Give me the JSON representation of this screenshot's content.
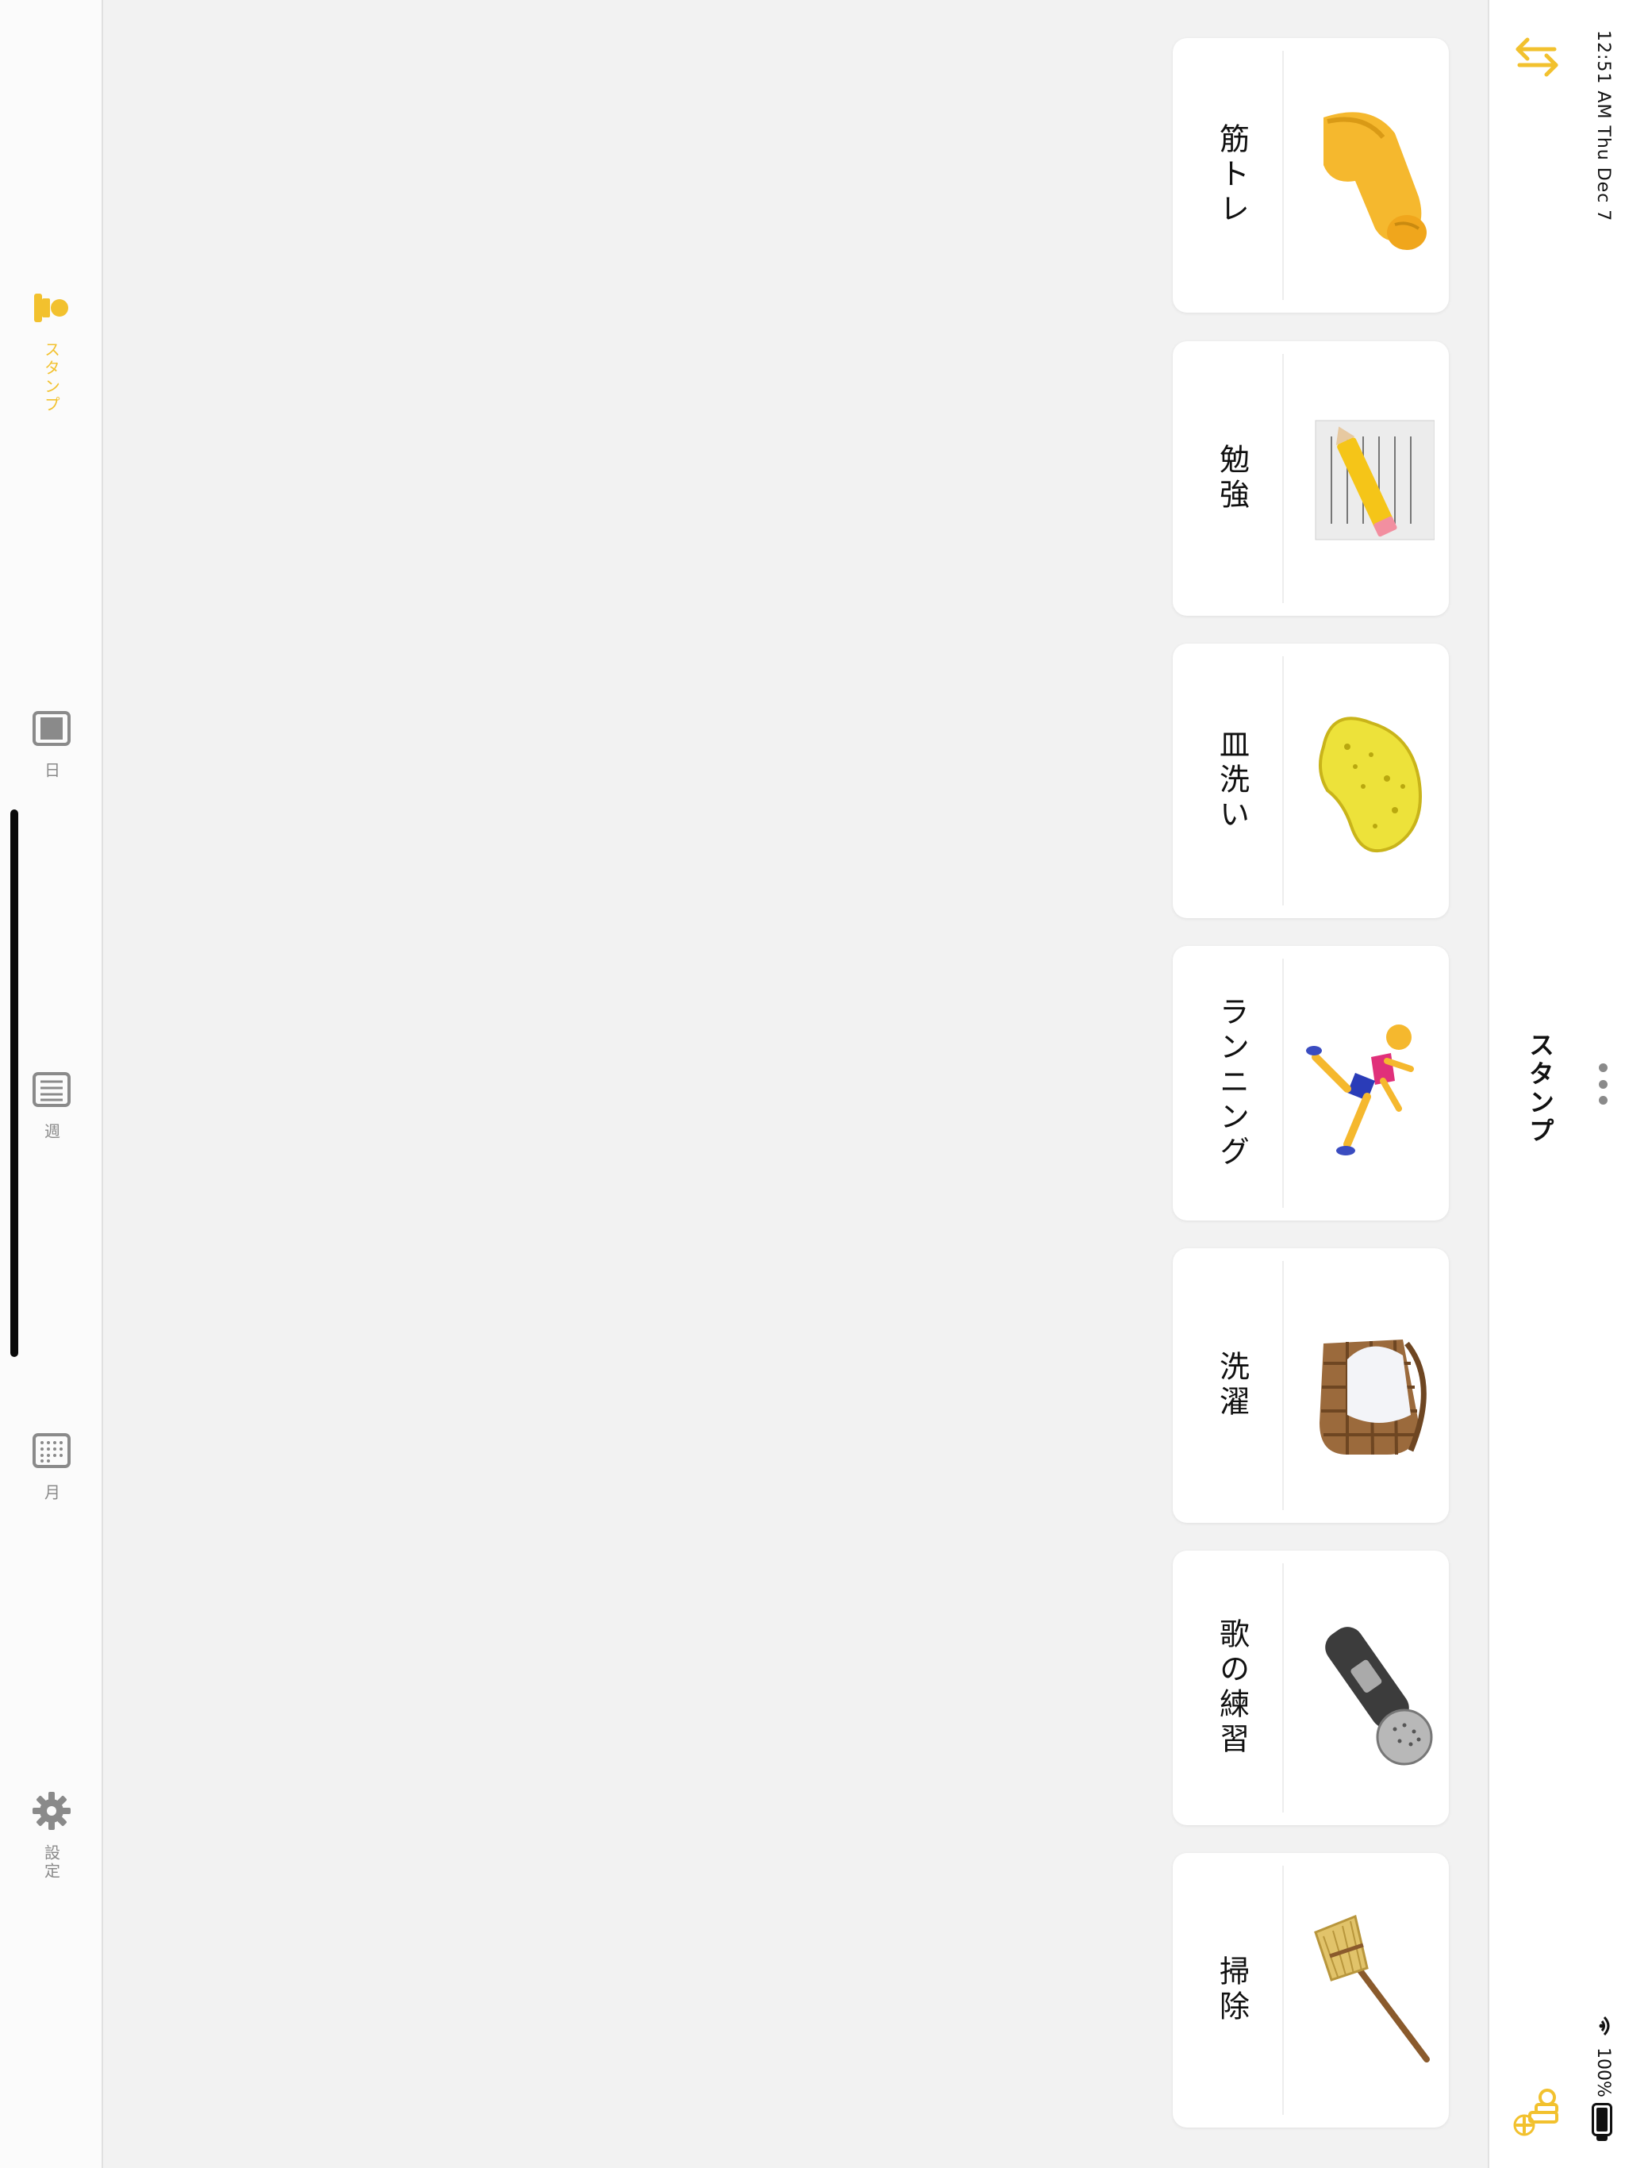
{
  "status_bar": {
    "time_date": "12:51 AM   Thu Dec 7",
    "battery": "100%"
  },
  "header": {
    "title": "スタンプ",
    "swap_icon": "swap-arrows-icon",
    "more_icon": "more-dots-icon",
    "add_icon": "add-stamp-icon"
  },
  "stamps": [
    {
      "label": "筋トレ",
      "icon": "flexed-biceps-icon"
    },
    {
      "label": "勉強",
      "icon": "memo-pencil-icon"
    },
    {
      "label": "皿洗い",
      "icon": "sponge-icon"
    },
    {
      "label": "ランニング",
      "icon": "running-person-icon"
    },
    {
      "label": "洗濯",
      "icon": "laundry-basket-icon"
    },
    {
      "label": "歌の練習",
      "icon": "microphone-icon"
    },
    {
      "label": "掃除",
      "icon": "broom-icon"
    }
  ],
  "tabs": [
    {
      "label": "スタンプ",
      "icon": "stamp-icon",
      "active": true
    },
    {
      "label": "日",
      "icon": "day-view-icon"
    },
    {
      "label": "週",
      "icon": "week-view-icon"
    },
    {
      "label": "月",
      "icon": "month-calendar-icon"
    },
    {
      "label": "設定",
      "icon": "gear-icon"
    }
  ],
  "colors": {
    "accent": "#f2c12e",
    "inactive": "#8a8a8a",
    "background": "#f2f2f2"
  }
}
